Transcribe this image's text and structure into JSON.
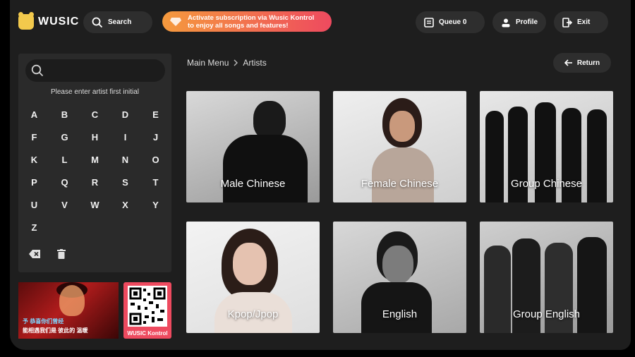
{
  "app": {
    "logo_text": "WUSIC"
  },
  "topbar": {
    "search_label": "Search",
    "promo_line1": "Activate subscription via Wusic Kontrol",
    "promo_line2": "to enjoy all songs and features!",
    "queue_label": "Queue 0",
    "profile_label": "Profile",
    "exit_label": "Exit"
  },
  "search_panel": {
    "input_value": "",
    "hint": "Please enter artist first initial",
    "letters": [
      "A",
      "B",
      "C",
      "D",
      "E",
      "F",
      "G",
      "H",
      "I",
      "J",
      "K",
      "L",
      "M",
      "N",
      "O",
      "P",
      "Q",
      "R",
      "S",
      "T",
      "U",
      "V",
      "W",
      "X",
      "Y",
      "Z"
    ],
    "actions": [
      "backspace-icon",
      "clear-icon"
    ]
  },
  "promo_thumb": {
    "line1": "予 恭喜你们曾经",
    "line2": "能相遇我们是 彼此的 温暖"
  },
  "qr": {
    "label": "WUSIC Kontrol"
  },
  "breadcrumb": {
    "root": "Main Menu",
    "separator_icon": "chevron-right-icon",
    "current": "Artists"
  },
  "return_label": "Return",
  "categories": [
    {
      "label": "Male Chinese"
    },
    {
      "label": "Female Chinese"
    },
    {
      "label": "Group Chinese"
    },
    {
      "label": "Kpop/Jpop"
    },
    {
      "label": "English"
    },
    {
      "label": "Group English"
    }
  ],
  "colors": {
    "accent_gradient_start": "#f59a3d",
    "accent_gradient_end": "#ee4a5f",
    "logo": "#f2c94c",
    "background": "#1e1e1e"
  }
}
